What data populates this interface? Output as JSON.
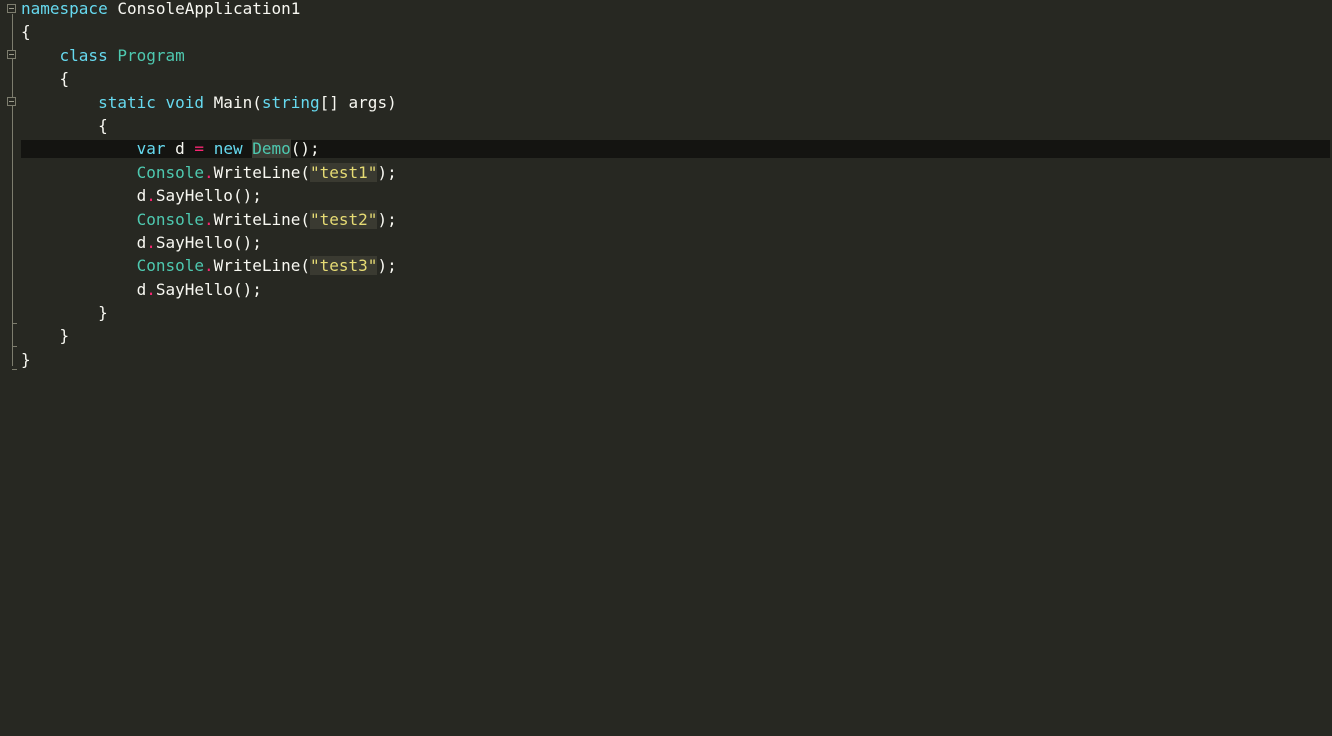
{
  "code": {
    "line1": {
      "kw": "namespace",
      "name": "ConsoleApplication1"
    },
    "line2": {
      "brace": "{"
    },
    "line3": {
      "kw": "class",
      "name": "Program"
    },
    "line4": {
      "brace": "{"
    },
    "line5": {
      "kw1": "static",
      "kw2": "void",
      "name": "Main(",
      "type": "string",
      "rest": "[] args)"
    },
    "line6": {
      "brace": "{"
    },
    "line7": {
      "kw": "var",
      "var": "d",
      "eq": "=",
      "kw2": "new",
      "type": "Demo",
      "rest": "();"
    },
    "line8": {
      "cls": "Console",
      "dot": ".",
      "method": "WriteLine(",
      "str": "\"test1\"",
      "end": ");"
    },
    "line9": {
      "obj": "d",
      "dot": ".",
      "call": "SayHello();"
    },
    "line10": {
      "cls": "Console",
      "dot": ".",
      "method": "WriteLine(",
      "str": "\"test2\"",
      "end": ");"
    },
    "line11": {
      "obj": "d",
      "dot": ".",
      "call": "SayHello();"
    },
    "line12": {
      "cls": "Console",
      "dot": ".",
      "method": "WriteLine(",
      "str": "\"test3\"",
      "end": ");"
    },
    "line13": {
      "obj": "d",
      "dot": ".",
      "call": "SayHello();"
    },
    "line14": {
      "brace": "}"
    },
    "line15": {
      "brace": "}"
    },
    "line16": {
      "brace": "}"
    }
  },
  "colors": {
    "background": "#272822",
    "keyword": "#66d9ef",
    "type": "#4ec9b0",
    "string": "#e6db74",
    "operator": "#f92672",
    "text": "#f8f8f2",
    "current_line": "#141411"
  }
}
